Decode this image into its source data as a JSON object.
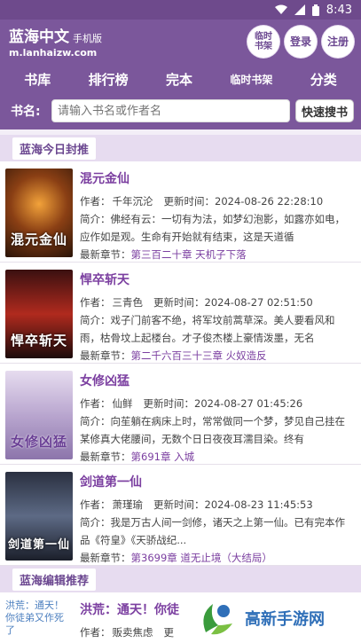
{
  "status": {
    "time": "8:43"
  },
  "header": {
    "site_name": "蓝海中文",
    "site_sub": "手机版",
    "domain": "m.lanhaizw.com",
    "btn_bookshelf": "临时\n书架",
    "btn_login": "登录",
    "btn_register": "注册"
  },
  "nav": {
    "items": [
      "书库",
      "排行榜",
      "完本",
      "临时书架",
      "分类"
    ]
  },
  "search": {
    "label": "书名:",
    "placeholder": "请输入书名或作者名",
    "button": "快速搜书"
  },
  "today": {
    "heading": "蓝海今日封推",
    "books": [
      {
        "title": "混元金仙",
        "cover_text": "混元金仙",
        "author_label": "作者：",
        "author": "千年沉沦",
        "update_label": "更新时间：",
        "update": "2024-08-26 22:28:10",
        "intro_label": "简介：",
        "intro": "佛经有云：一切有为法，如梦幻泡影，如露亦如电，应作如是观。生命有开始就有结束，这是天道循",
        "latest_label": "最新章节：",
        "latest": "第三百二十章 天机子下落"
      },
      {
        "title": "悍卒斩天",
        "cover_text": "悍卒斩天",
        "author_label": "作者：",
        "author": "三青色",
        "update_label": "更新时间：",
        "update": "2024-08-27 02:51:50",
        "intro_label": "简介：",
        "intro": "戏子门前客不绝，将军坟前蒿草深。美人要看风和雨，枯骨坟上起楼台。才子俊杰楼上豪情泼墨，无名",
        "latest_label": "最新章节：",
        "latest": "第二千六百三十三章 火奴造反"
      },
      {
        "title": "女修凶猛",
        "cover_text": "女修凶猛",
        "author_label": "作者：",
        "author": "仙鲜",
        "update_label": "更新时间：",
        "update": "2024-08-27 01:45:26",
        "intro_label": "简介：",
        "intro": "向苼躺在病床上时，常常做同一个梦，梦见自己挂在某修真大佬腰间，无数个日日夜夜耳濡目染。终有",
        "latest_label": "最新章节：",
        "latest": "第691章 入城"
      },
      {
        "title": "剑道第一仙",
        "cover_text": "剑道第一仙",
        "author_label": "作者：",
        "author": "萧瑾瑜",
        "update_label": "更新时间：",
        "update": "2024-08-23 11:45:53",
        "intro_label": "简介：",
        "intro": "我是万古人间一剑修，诸天之上第一仙。已有完本作品《符皇》《天骄战纪...",
        "latest_label": "最新章节：",
        "latest": "第3699章 道无止境（大结局）"
      }
    ]
  },
  "editor": {
    "heading": "蓝海编辑推荐",
    "book": {
      "cover_alt": "洪荒：通天！你徒弟又作死了",
      "title": "洪荒：通天！你徒",
      "author_label": "作者：",
      "author": "贩卖焦虑",
      "update_label": "更"
    }
  },
  "watermark": {
    "brand": "高新手游网"
  },
  "colors": {
    "primary": "#7b579b",
    "accent": "#7b3fa0",
    "section_bg": "#e7dcf0"
  }
}
